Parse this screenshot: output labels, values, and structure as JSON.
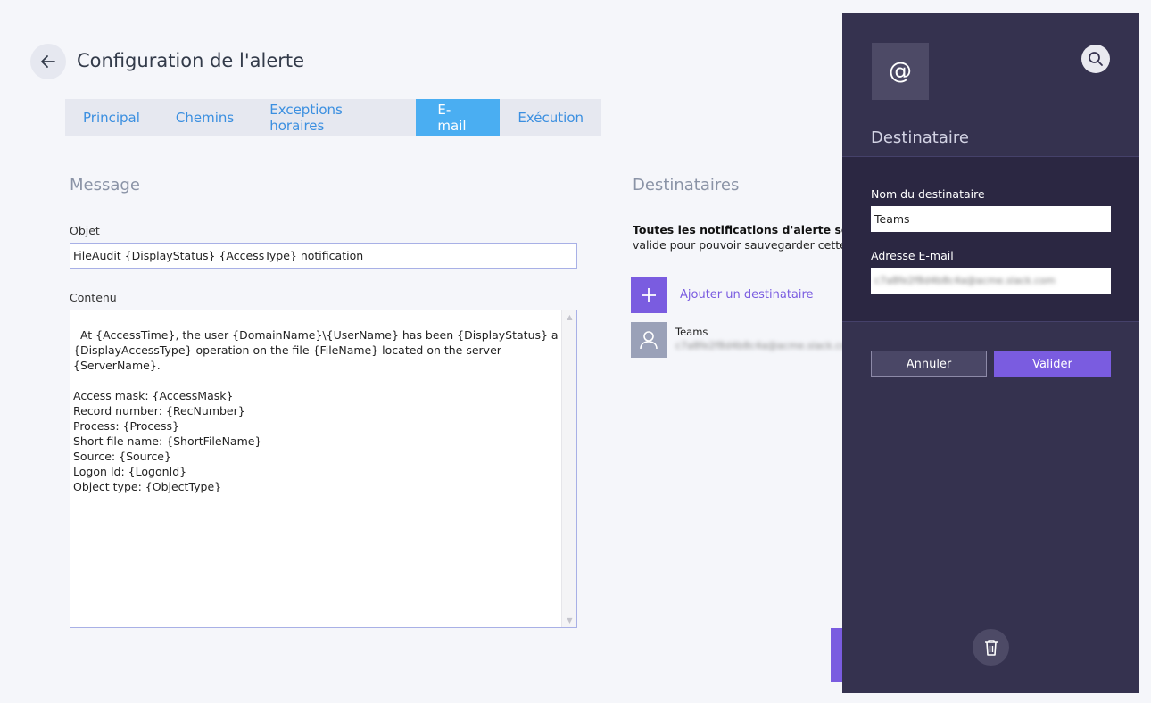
{
  "header": {
    "title": "Configuration de l'alerte",
    "back_icon": "arrow-left-icon"
  },
  "tabs": [
    {
      "label": "Principal",
      "active": false
    },
    {
      "label": "Chemins",
      "active": false
    },
    {
      "label": "Exceptions horaires",
      "active": false
    },
    {
      "label": "E-mail",
      "active": true
    },
    {
      "label": "Exécution",
      "active": false
    }
  ],
  "message": {
    "heading": "Message",
    "subject_label": "Objet",
    "subject_value": "FileAudit {DisplayStatus} {AccessType} notification",
    "content_label": "Contenu",
    "content_value": "At {AccessTime}, the user {DomainName}\\{UserName} has been {DisplayStatus} a\n{DisplayAccessType} operation on the file {FileName} located on the server {ServerName}.\n\nAccess mask: {AccessMask}\nRecord number: {RecNumber}\nProcess: {Process}\nShort file name: {ShortFileName}\nSource: {Source}\nLogon Id: {LogonId}\nObject type: {ObjectType}"
  },
  "recipients": {
    "heading": "Destinataires",
    "note_bold": "Toutes les notifications d'alerte sont e",
    "note": "valide pour pouvoir sauvegarder cette a",
    "add_label": "Ajouter un destinataire",
    "list": [
      {
        "name": "Teams",
        "email": "c7a8fe2f8d4b8c4a@acme.slack.com"
      }
    ]
  },
  "panel": {
    "title": "Destinataire",
    "name_label": "Nom du destinataire",
    "name_value": "Teams",
    "email_label": "Adresse E-mail",
    "email_value": "c7a8fe2f8d4b8c4a@acme.slack.com",
    "cancel_label": "Annuler",
    "ok_label": "Valider",
    "at_symbol": "@"
  },
  "colors": {
    "accent_purple": "#7a5ce0",
    "tab_active": "#4aaef2",
    "panel_bg": "#35324f"
  }
}
